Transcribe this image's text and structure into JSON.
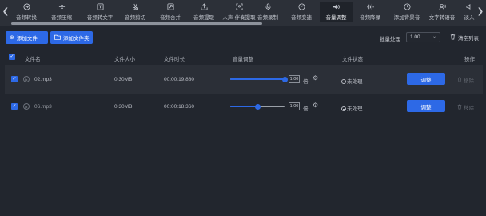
{
  "toolbar": {
    "items": [
      {
        "label": "音频转换",
        "icon": "convert-icon"
      },
      {
        "label": "音频压缩",
        "icon": "compress-icon"
      },
      {
        "label": "音频转文字",
        "icon": "speech-to-text-icon"
      },
      {
        "label": "音频剪切",
        "icon": "scissors-icon"
      },
      {
        "label": "音频合并",
        "icon": "merge-icon"
      },
      {
        "label": "音频提取",
        "icon": "extract-icon"
      },
      {
        "label": "人声-伴奏提取",
        "icon": "vocal-separate-icon"
      },
      {
        "label": "音频录制",
        "icon": "microphone-icon"
      },
      {
        "label": "音频变速",
        "icon": "speed-icon"
      },
      {
        "label": "音量调整",
        "icon": "volume-icon"
      },
      {
        "label": "音频降噪",
        "icon": "denoise-icon"
      },
      {
        "label": "添加背景音",
        "icon": "background-music-icon"
      },
      {
        "label": "文字转语音",
        "icon": "text-to-speech-icon"
      },
      {
        "label": "淡入",
        "icon": "fade-in-icon"
      }
    ],
    "active_index": 9
  },
  "actions": {
    "add_file": "添加文件",
    "add_folder": "添加文件夹",
    "batch_label": "批量处理",
    "batch_value": "1.00",
    "clear_list": "清空列表"
  },
  "table": {
    "columns": {
      "name": "文件名",
      "size": "文件大小",
      "duration": "文件时长",
      "volume": "音量调整",
      "status": "文件状态",
      "action": "操作"
    },
    "rows": [
      {
        "name": "02.mp3",
        "size": "0.30MB",
        "duration": "00:00:19.880",
        "volume": "1.00",
        "volume_fraction": 1.0,
        "unit": "倍",
        "status": "未处理",
        "adjust": "调整",
        "remove": "移除"
      },
      {
        "name": "06.mp3",
        "size": "0.30MB",
        "duration": "00:00:18.360",
        "volume": "1.00",
        "volume_fraction": 0.5,
        "unit": "倍",
        "status": "未处理",
        "adjust": "调整",
        "remove": "移除"
      }
    ]
  },
  "colors": {
    "accent": "#2d69e6",
    "background": "#22262e",
    "toolbar": "#2c3038"
  }
}
